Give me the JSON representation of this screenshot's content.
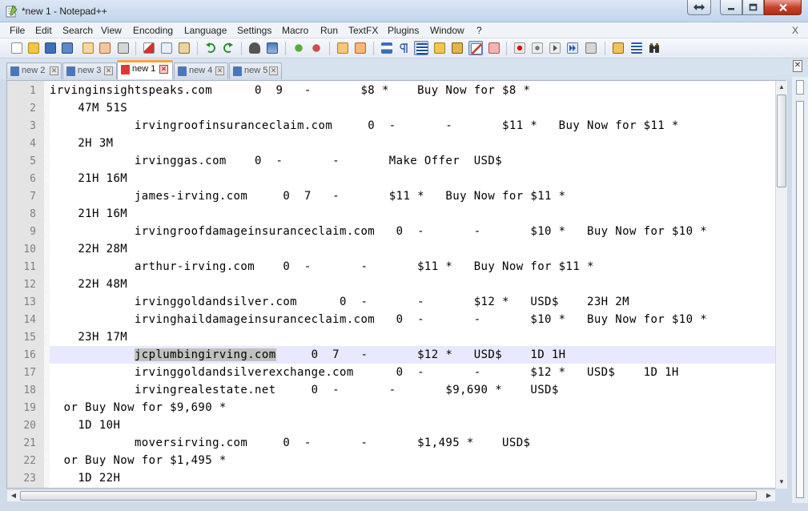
{
  "window": {
    "title": "*new 1 - Notepad++"
  },
  "menu": {
    "items": [
      "File",
      "Edit",
      "Search",
      "View",
      "Encoding",
      "Language",
      "Settings",
      "Macro",
      "Run",
      "TextFX",
      "Plugins",
      "Window",
      "?"
    ],
    "close_label": "X"
  },
  "toolbar": {
    "icons": [
      "new-file-icon",
      "open-file-icon",
      "save-icon",
      "save-all-icon",
      "close-icon",
      "close-all-icon",
      "print-icon",
      "cut-icon",
      "copy-icon",
      "paste-icon",
      "undo-icon",
      "redo-icon",
      "find-icon",
      "replace-icon",
      "zoom-in-icon",
      "zoom-out-icon",
      "sync-vertical-icon",
      "sync-horizontal-icon",
      "word-wrap-icon",
      "show-all-chars-icon",
      "indent-guide-icon",
      "user-lang-icon",
      "doc-map-icon",
      "function-list-icon",
      "folder-workspace-icon",
      "record-macro-icon",
      "stop-macro-icon",
      "play-macro-icon",
      "run-macro-multiple-icon",
      "save-macro-icon",
      "launch-browser-icon",
      "plugin-icon",
      "binoculars-icon"
    ]
  },
  "colors": {
    "tab_active_accent": "#f6a34a",
    "current_line": "#e8e8ff",
    "selection": "#c0c0c0",
    "line_number": "#808080"
  },
  "tabs": [
    {
      "label": "new 2",
      "active": false
    },
    {
      "label": "new 3",
      "active": false
    },
    {
      "label": "new 1",
      "active": true
    },
    {
      "label": "new 4",
      "active": false
    },
    {
      "label": "new 5",
      "active": false
    }
  ],
  "editor": {
    "current_line": 16,
    "lines": [
      {
        "n": "1",
        "indent": "",
        "text": "irvinginsightspeaks.com      0  9   -       $8 *    Buy Now for $8 *"
      },
      {
        "n": "2",
        "indent": "    ",
        "text": "47M 51S"
      },
      {
        "n": "3",
        "indent": "            ",
        "text": "irvingroofinsuranceclaim.com     0  -       -       $11 *   Buy Now for $11 *"
      },
      {
        "n": "4",
        "indent": "    ",
        "text": "2H 3M"
      },
      {
        "n": "5",
        "indent": "            ",
        "text": "irvinggas.com    0  -       -       Make Offer  USD$"
      },
      {
        "n": "6",
        "indent": "    ",
        "text": "21H 16M"
      },
      {
        "n": "7",
        "indent": "            ",
        "text": "james-irving.com     0  7   -       $11 *   Buy Now for $11 *"
      },
      {
        "n": "8",
        "indent": "    ",
        "text": "21H 16M"
      },
      {
        "n": "9",
        "indent": "            ",
        "text": "irvingroofdamageinsuranceclaim.com   0  -       -       $10 *   Buy Now for $10 *"
      },
      {
        "n": "10",
        "indent": "    ",
        "text": "22H 28M"
      },
      {
        "n": "11",
        "indent": "            ",
        "text": "arthur-irving.com    0  -       -       $11 *   Buy Now for $11 *"
      },
      {
        "n": "12",
        "indent": "    ",
        "text": "22H 48M"
      },
      {
        "n": "13",
        "indent": "            ",
        "text": "irvinggoldandsilver.com      0  -       -       $12 *   USD$    23H 2M"
      },
      {
        "n": "14",
        "indent": "            ",
        "text": "irvinghaildamageinsuranceclaim.com   0  -       -       $10 *   Buy Now for $10 *"
      },
      {
        "n": "15",
        "indent": "    ",
        "text": "23H 17M"
      },
      {
        "n": "16",
        "indent": "            ",
        "selected": "jcplumbingirving.com",
        "text": "     0  7   -       $12 *   USD$    1D 1H"
      },
      {
        "n": "17",
        "indent": "            ",
        "text": "irvinggoldandsilverexchange.com      0  -       -       $12 *   USD$    1D 1H"
      },
      {
        "n": "18",
        "indent": "            ",
        "text": "irvingrealestate.net     0  -       -       $9,690 *    USD$"
      },
      {
        "n": "19",
        "indent": "  ",
        "text": "or Buy Now for $9,690 *"
      },
      {
        "n": "20",
        "indent": "    ",
        "text": "1D 10H"
      },
      {
        "n": "21",
        "indent": "            ",
        "text": "moversirving.com     0  -       -       $1,495 *    USD$"
      },
      {
        "n": "22",
        "indent": "  ",
        "text": "or Buy Now for $1,495 *"
      },
      {
        "n": "23",
        "indent": "    ",
        "text": "1D 22H"
      }
    ]
  },
  "scrollbar_position": {
    "vertical_fraction": 0.0,
    "horizontal_fraction": 0.0
  }
}
